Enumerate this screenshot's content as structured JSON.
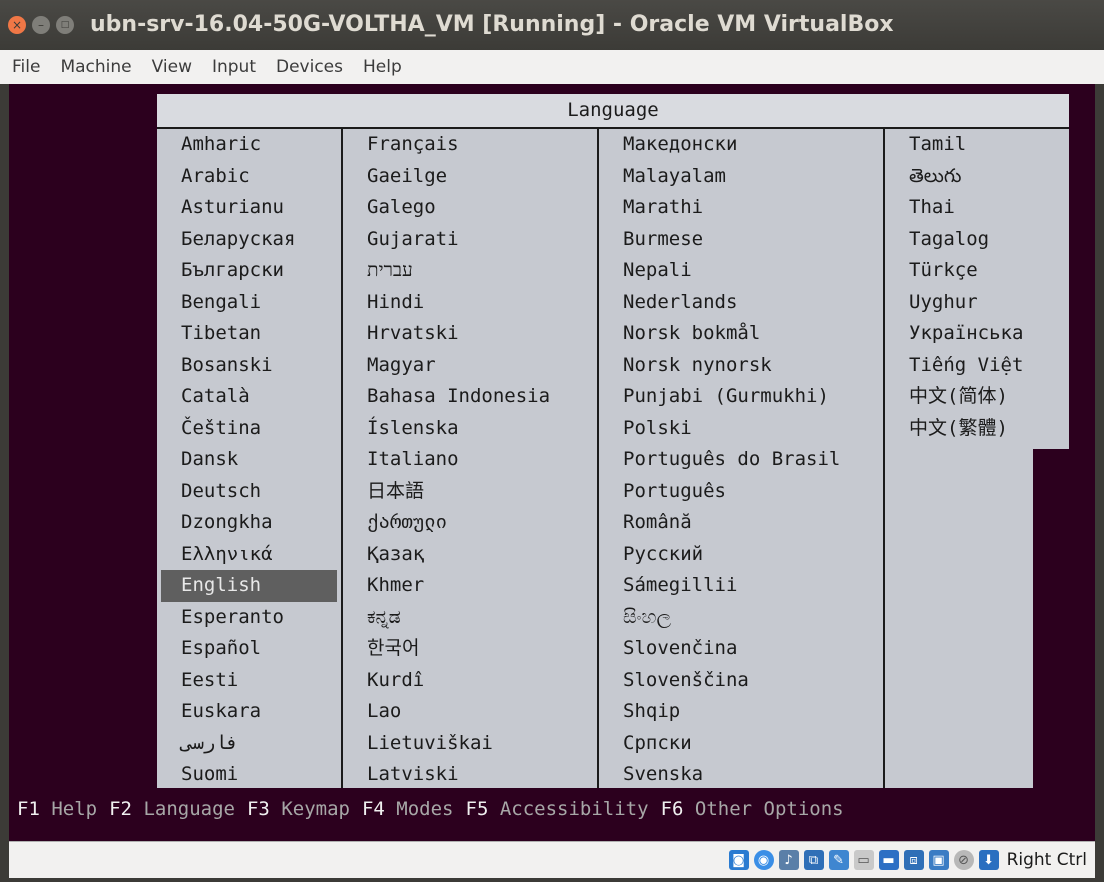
{
  "window": {
    "title": "ubn-srv-16.04-50G-VOLTHA_VM [Running] - Oracle VM VirtualBox"
  },
  "menubar": {
    "items": [
      "File",
      "Machine",
      "View",
      "Input",
      "Devices",
      "Help"
    ]
  },
  "dialog": {
    "title": "Language",
    "selected": "English",
    "columns": [
      [
        "Amharic",
        "Arabic",
        "Asturianu",
        "Беларуская",
        "Български",
        "Bengali",
        "Tibetan",
        "Bosanski",
        "Català",
        "Čeština",
        "Dansk",
        "Deutsch",
        "Dzongkha",
        "Ελληνικά",
        "English",
        "Esperanto",
        "Español",
        "Eesti",
        "Euskara",
        "فارسی",
        "Suomi"
      ],
      [
        "Français",
        "Gaeilge",
        "Galego",
        "Gujarati",
        "עברית",
        "Hindi",
        "Hrvatski",
        "Magyar",
        "Bahasa Indonesia",
        "Íslenska",
        "Italiano",
        "日本語",
        "ქართული",
        "Қазақ",
        "Khmer",
        "ಕನ್ನಡ",
        "한국어",
        "Kurdî",
        "Lao",
        "Lietuviškai",
        "Latviski"
      ],
      [
        "Македонски",
        "Malayalam",
        "Marathi",
        "Burmese",
        "Nepali",
        "Nederlands",
        "Norsk bokmål",
        "Norsk nynorsk",
        "Punjabi (Gurmukhi)",
        "Polski",
        "Português do Brasil",
        "Português",
        "Română",
        "Русский",
        "Sámegillii",
        "සිංහල",
        "Slovenčina",
        "Slovenščina",
        "Shqip",
        "Српски",
        "Svenska"
      ],
      [
        "Tamil",
        "తెలుగు",
        "Thai",
        "Tagalog",
        "Türkçe",
        "Uyghur",
        "Українська",
        "Tiếng Việt",
        "中文(简体)",
        "中文(繁體)"
      ]
    ]
  },
  "fkeys": [
    {
      "key": "F1",
      "label": "Help"
    },
    {
      "key": "F2",
      "label": "Language"
    },
    {
      "key": "F3",
      "label": "Keymap"
    },
    {
      "key": "F4",
      "label": "Modes"
    },
    {
      "key": "F5",
      "label": "Accessibility"
    },
    {
      "key": "F6",
      "label": "Other Options"
    }
  ],
  "statusbar": {
    "host_key": "Right Ctrl",
    "icons": [
      "hard-disk-icon",
      "optical-drive-icon",
      "audio-icon",
      "network-icon",
      "usb-icon",
      "shared-folders-icon",
      "display-icon",
      "video-capture-icon",
      "cpu-icon",
      "mouse-integration-icon",
      "keyboard-capture-icon"
    ]
  },
  "colors": {
    "vm_background": "#2c001e",
    "dialog_background": "#c6c9d0",
    "selection": "#5f5f5f",
    "close_button": "#f07746"
  }
}
